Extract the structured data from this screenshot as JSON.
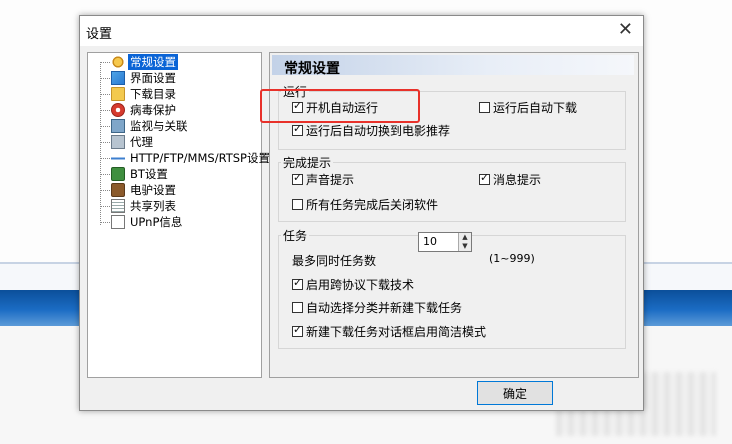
{
  "dialog": {
    "title": "设置",
    "close_glyph": "✕",
    "ok_label": "确定"
  },
  "tree": {
    "items": [
      {
        "label": "常规设置",
        "icon": "general-settings-icon",
        "selected": true
      },
      {
        "label": "界面设置",
        "icon": "interface-icon"
      },
      {
        "label": "下载目录",
        "icon": "folder-icon"
      },
      {
        "label": "病毒保护",
        "icon": "virus-shield-icon"
      },
      {
        "label": "监视与关联",
        "icon": "monitor-icon"
      },
      {
        "label": "代理",
        "icon": "proxy-icon"
      },
      {
        "label": "HTTP/FTP/MMS/RTSP设置",
        "icon": "protocol-icon"
      },
      {
        "label": "BT设置",
        "icon": "bt-icon"
      },
      {
        "label": "电驴设置",
        "icon": "emule-icon"
      },
      {
        "label": "共享列表",
        "icon": "share-list-icon"
      },
      {
        "label": "UPnP信息",
        "icon": "upnp-icon"
      }
    ]
  },
  "panel": {
    "title": "常规设置",
    "groups": {
      "run": {
        "legend": "运行",
        "options": [
          {
            "label": "开机自动运行",
            "checked": true
          },
          {
            "label": "运行后自动下载",
            "checked": false
          },
          {
            "label": "运行后自动切换到电影推荐",
            "checked": true
          }
        ]
      },
      "notify": {
        "legend": "完成提示",
        "options": [
          {
            "label": "声音提示",
            "checked": true
          },
          {
            "label": "消息提示",
            "checked": true
          },
          {
            "label": "所有任务完成后关闭软件",
            "checked": false
          }
        ]
      },
      "task": {
        "legend": "任务",
        "max_tasks_label": "最多同时任务数",
        "max_tasks_value": "10",
        "max_tasks_range": "(1~999)",
        "options": [
          {
            "label": "启用跨协议下载技术",
            "checked": true
          },
          {
            "label": "自动选择分类并新建下载任务",
            "checked": false
          },
          {
            "label": "新建下载任务对话框启用简洁模式",
            "checked": true
          }
        ]
      }
    }
  },
  "colors": {
    "selection": "#0a64d6",
    "highlight_box": "#e8312a",
    "band": "#1b6cc4"
  }
}
